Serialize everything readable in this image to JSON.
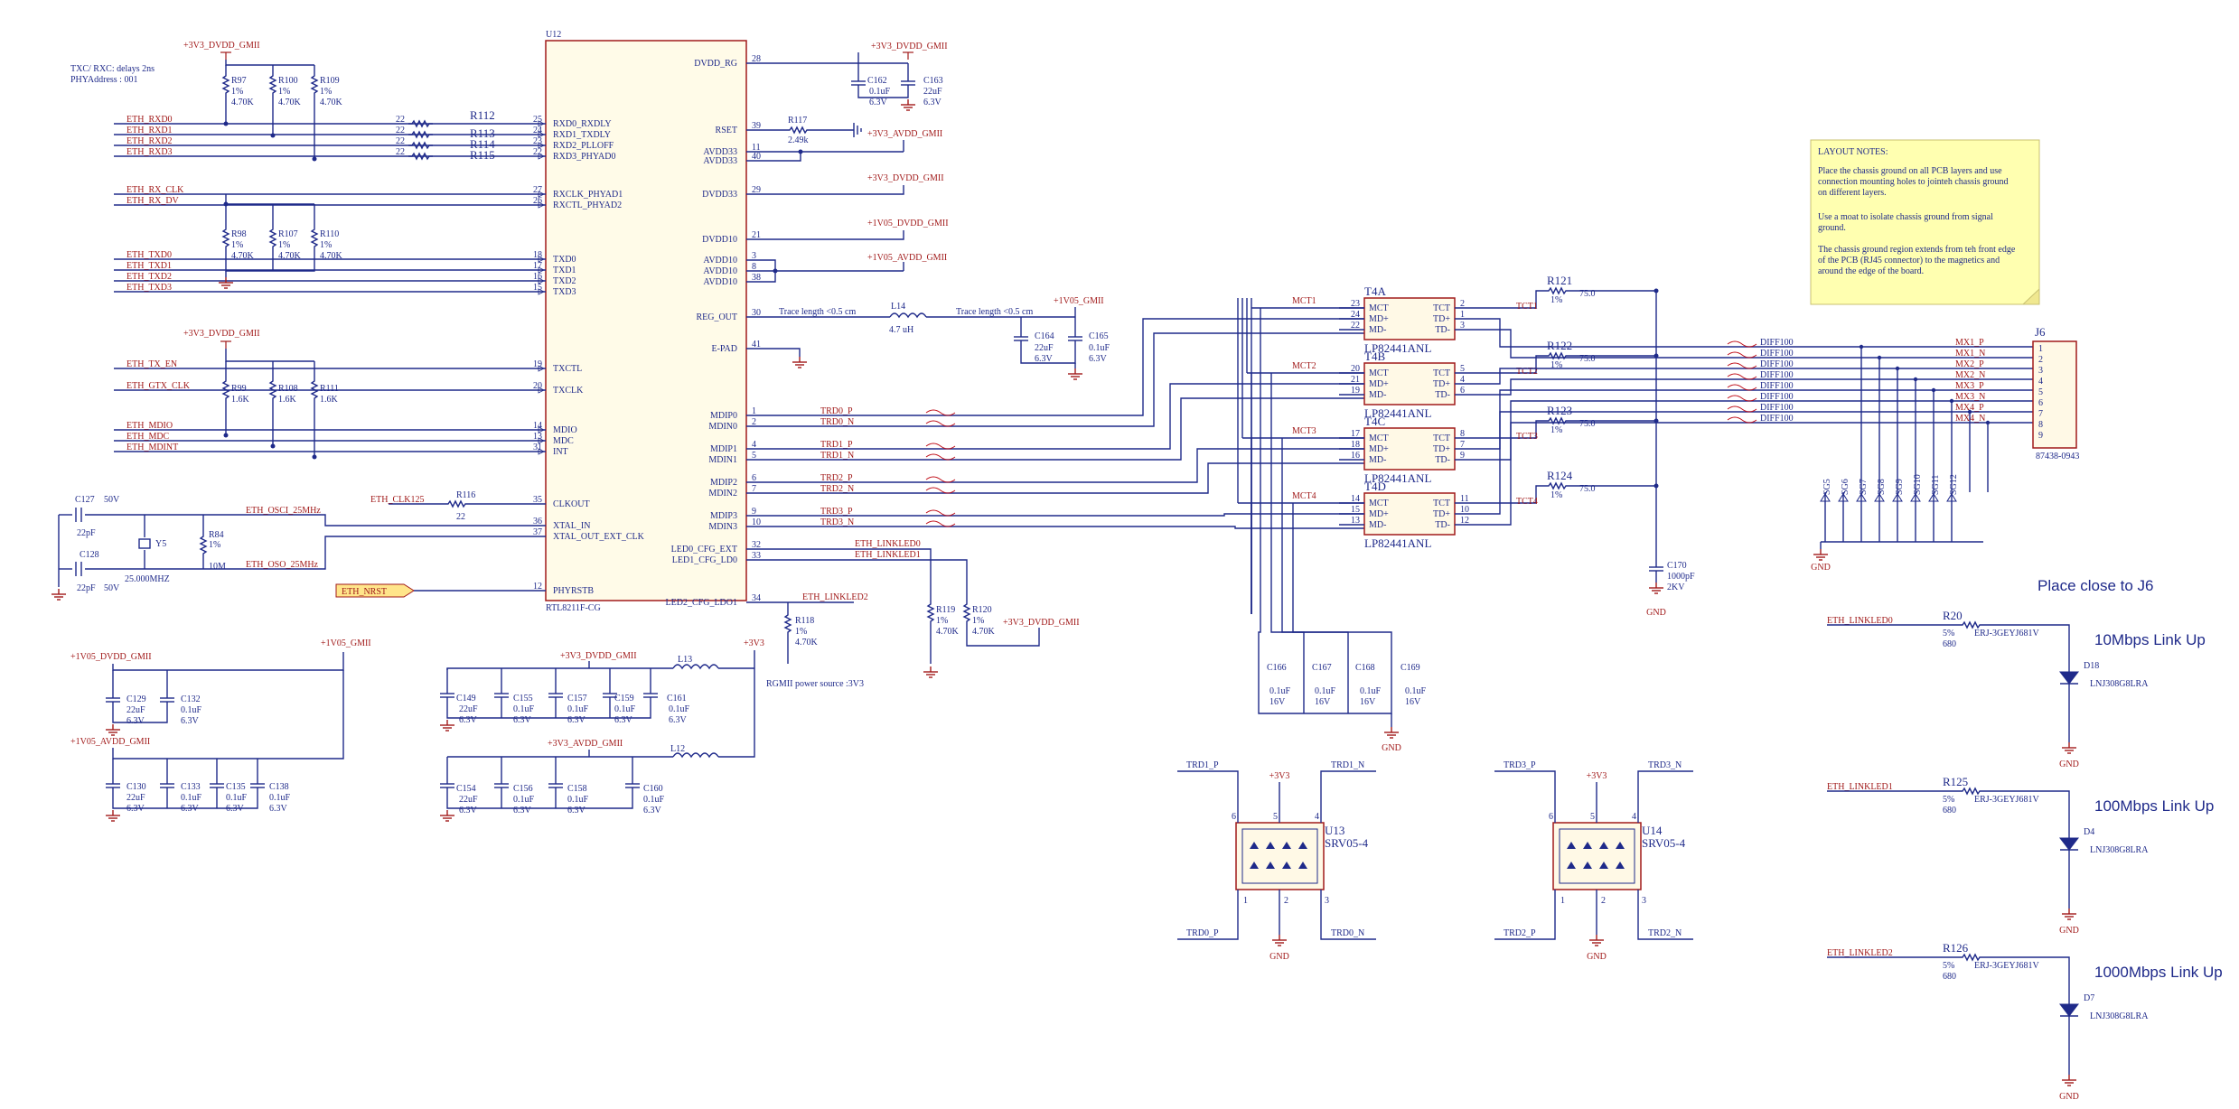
{
  "notes": {
    "delays": "TXC/ RXC: delays 2ns",
    "phy_address": "PHYAddress : 001",
    "rgmii": "RGMII power source :3V3"
  },
  "u12": {
    "ref": "U12",
    "part": "RTL8211F-CG",
    "left_pins": [
      {
        "num": "25",
        "name": "RXD0_RXDLY",
        "net": "ETH_RXD0",
        "res": "R112",
        "val": "22"
      },
      {
        "num": "24",
        "name": "RXD1_TXDLY",
        "net": "ETH_RXD1",
        "res": "R113",
        "val": "22"
      },
      {
        "num": "23",
        "name": "RXD2_PLLOFF",
        "net": "ETH_RXD2",
        "res": "R114",
        "val": "22"
      },
      {
        "num": "22",
        "name": "RXD3_PHYAD0",
        "net": "ETH_RXD3",
        "res": "R115",
        "val": "22"
      },
      {
        "num": "27",
        "name": "RXCLK_PHYAD1",
        "net": "ETH_RX_CLK"
      },
      {
        "num": "26",
        "name": "RXCTL_PHYAD2",
        "net": "ETH_RX_DV"
      },
      {
        "num": "18",
        "name": "TXD0",
        "net": "ETH_TXD0"
      },
      {
        "num": "17",
        "name": "TXD1",
        "net": "ETH_TXD1"
      },
      {
        "num": "16",
        "name": "TXD2",
        "net": "ETH_TXD2"
      },
      {
        "num": "15",
        "name": "TXD3",
        "net": "ETH_TXD3"
      },
      {
        "num": "19",
        "name": "TXCTL",
        "net": "ETH_TX_EN"
      },
      {
        "num": "20",
        "name": "TXCLK",
        "net": "ETH_GTX_CLK"
      },
      {
        "num": "14",
        "name": "MDIO",
        "net": "ETH_MDIO"
      },
      {
        "num": "13",
        "name": "MDC",
        "net": "ETH_MDC"
      },
      {
        "num": "31",
        "name": "INT",
        "net": "ETH_MDINT"
      },
      {
        "num": "35",
        "name": "CLKOUT",
        "net": "ETH_CLK125"
      },
      {
        "num": "36",
        "name": "XTAL_IN",
        "net": "ETH_OSCI_25MHz"
      },
      {
        "num": "37",
        "name": "XTAL_OUT_EXT_CLK",
        "net": "ETH_OSO_25MHz"
      },
      {
        "num": "12",
        "name": "PHYRSTB",
        "net": "ETH_NRST"
      }
    ],
    "right_pins": [
      {
        "num": "28",
        "name": "DVDD_RG"
      },
      {
        "num": "39",
        "name": "RSET"
      },
      {
        "num": "11",
        "name": "AVDD33"
      },
      {
        "num": "40",
        "name": "AVDD33"
      },
      {
        "num": "29",
        "name": "DVDD33"
      },
      {
        "num": "21",
        "name": "DVDD10"
      },
      {
        "num": "3",
        "name": "AVDD10"
      },
      {
        "num": "8",
        "name": "AVDD10"
      },
      {
        "num": "38",
        "name": "AVDD10"
      },
      {
        "num": "30",
        "name": "REG_OUT"
      },
      {
        "num": "41",
        "name": "E-PAD"
      },
      {
        "num": "1",
        "name": "MDIP0",
        "net": "TRD0_P"
      },
      {
        "num": "2",
        "name": "MDIN0",
        "net": "TRD0_N"
      },
      {
        "num": "4",
        "name": "MDIP1",
        "net": "TRD1_P"
      },
      {
        "num": "5",
        "name": "MDIN1",
        "net": "TRD1_N"
      },
      {
        "num": "6",
        "name": "MDIP2",
        "net": "TRD2_P"
      },
      {
        "num": "7",
        "name": "MDIN2",
        "net": "TRD2_N"
      },
      {
        "num": "9",
        "name": "MDIP3",
        "net": "TRD3_P"
      },
      {
        "num": "10",
        "name": "MDIN3",
        "net": "TRD3_N"
      },
      {
        "num": "32",
        "name": "LED0_CFG_EXT",
        "net": "ETH_LINKLED0"
      },
      {
        "num": "33",
        "name": "LED1_CFG_LD0",
        "net": "ETH_LINKLED1"
      },
      {
        "num": "34",
        "name": "LED2_CFG_LDO1",
        "net": "ETH_LINKLED2"
      }
    ]
  },
  "power": {
    "p3v3_dvdd": "+3V3_DVDD_GMII",
    "p3v3_avdd": "+3V3_AVDD_GMII",
    "p1v05_dvdd": "+1V05_DVDD_GMII",
    "p1v05_avdd": "+1V05_AVDD_GMII",
    "p1v05": "+1V05_GMII",
    "p3v3": "+3V3"
  },
  "pullups_top": [
    {
      "ref": "R97",
      "tol": "1%",
      "val": "4.70K"
    },
    {
      "ref": "R100",
      "tol": "1%",
      "val": "4.70K"
    },
    {
      "ref": "R109",
      "tol": "1%",
      "val": "4.70K"
    }
  ],
  "pulldowns": [
    {
      "ref": "R98",
      "tol": "1%",
      "val": "4.70K"
    },
    {
      "ref": "R107",
      "tol": "1%",
      "val": "4.70K"
    },
    {
      "ref": "R110",
      "tol": "1%",
      "val": "4.70K"
    }
  ],
  "mdio_pullups": [
    {
      "ref": "R99",
      "tol": "1%",
      "val": "1.6K"
    },
    {
      "ref": "R108",
      "tol": "1%",
      "val": "1.6K"
    },
    {
      "ref": "R111",
      "tol": "1%",
      "val": "1.6K"
    }
  ],
  "misc": {
    "r116": {
      "ref": "R116",
      "val": "22"
    },
    "r84": {
      "ref": "R84",
      "tol": "1%",
      "val": "10M"
    },
    "y5": {
      "ref": "Y5",
      "val": "25.000MHZ"
    },
    "c127": {
      "ref": "C127",
      "v": "50V",
      "val": "22pF"
    },
    "c128": {
      "ref": "C128",
      "val": "22pF",
      "v": "50V"
    },
    "r117": {
      "ref": "R117",
      "val": "2.49k"
    },
    "r118": {
      "ref": "R118",
      "tol": "1%",
      "val": "4.70K"
    },
    "r119": {
      "ref": "R119",
      "tol": "1%",
      "val": "4.70K"
    },
    "r120": {
      "ref": "R120",
      "tol": "1%",
      "val": "4.70K"
    },
    "c162": {
      "ref": "C162",
      "val": "0.1uF",
      "v": "6.3V"
    },
    "c163": {
      "ref": "C163",
      "val": "22uF",
      "v": "6.3V"
    },
    "l14": {
      "ref": "L14",
      "val": "4.7 uH"
    },
    "trace1": "Trace length <0.5 cm",
    "trace2": "Trace length <0.5 cm",
    "c164": {
      "ref": "C164",
      "val": "22uF",
      "v": "6.3V"
    },
    "c165": {
      "ref": "C165",
      "val": "0.1uF",
      "v": "6.3V"
    }
  },
  "decoupling": {
    "dvdd_gmii": [
      {
        "ref": "C129",
        "val": "22uF",
        "v": "6.3V"
      },
      {
        "ref": "C132",
        "val": "0.1uF",
        "v": "6.3V"
      }
    ],
    "avdd_gmii": [
      {
        "ref": "C130",
        "val": "22uF",
        "v": "6.3V"
      },
      {
        "ref": "C133",
        "val": "0.1uF",
        "v": "6.3V"
      },
      {
        "ref": "C135",
        "val": "0.1uF",
        "v": "6.3V"
      },
      {
        "ref": "C138",
        "val": "0.1uF",
        "v": "6.3V"
      }
    ],
    "dvdd33": [
      {
        "ref": "C149",
        "val": "22uF",
        "v": "6.3V"
      },
      {
        "ref": "C155",
        "val": "0.1uF",
        "v": "6.3V"
      },
      {
        "ref": "C157",
        "val": "0.1uF",
        "v": "6.3V"
      },
      {
        "ref": "C159",
        "val": "0.1uF",
        "v": "6.3V"
      },
      {
        "ref": "C161",
        "val": "0.1uF",
        "v": "6.3V"
      }
    ],
    "avdd33": [
      {
        "ref": "C154",
        "val": "22uF",
        "v": "6.3V"
      },
      {
        "ref": "C156",
        "val": "0.1uF",
        "v": "6.3V"
      },
      {
        "ref": "C158",
        "val": "0.1uF",
        "v": "6.3V"
      },
      {
        "ref": "C160",
        "val": "0.1uF",
        "v": "6.3V"
      }
    ],
    "l13": "L13",
    "l12": "L12"
  },
  "magnetics": {
    "part": "LP82441ANL",
    "pins": [
      "MCT",
      "MD+",
      "MD-",
      "TCT",
      "TD+",
      "TD-"
    ],
    "units": [
      {
        "ref": "T4A",
        "mct": "MCT1",
        "tct": "TCT1",
        "lp": [
          "23",
          "24",
          "22"
        ],
        "rp": [
          "2",
          "1",
          "3"
        ],
        "res": "R121",
        "tol": "1%",
        "val": "75.0"
      },
      {
        "ref": "T4B",
        "mct": "MCT2",
        "tct": "TCT2",
        "lp": [
          "20",
          "21",
          "19"
        ],
        "rp": [
          "5",
          "4",
          "6"
        ],
        "res": "R122",
        "tol": "1%",
        "val": "75.0"
      },
      {
        "ref": "T4C",
        "mct": "MCT3",
        "tct": "TCT3",
        "lp": [
          "17",
          "18",
          "16"
        ],
        "rp": [
          "8",
          "7",
          "9"
        ],
        "res": "R123",
        "tol": "1%",
        "val": "75.0"
      },
      {
        "ref": "T4D",
        "mct": "MCT4",
        "tct": "TCT4",
        "lp": [
          "14",
          "15",
          "13"
        ],
        "rp": [
          "11",
          "10",
          "12"
        ],
        "res": "R124",
        "tol": "1%",
        "val": "75.0"
      }
    ],
    "c170": {
      "ref": "C170",
      "val": "1000pF",
      "v": "2KV"
    },
    "caps": [
      {
        "ref": "C166",
        "val": "0.1uF",
        "v": "16V"
      },
      {
        "ref": "C167",
        "val": "0.1uF",
        "v": "16V"
      },
      {
        "ref": "C168",
        "val": "0.1uF",
        "v": "16V"
      },
      {
        "ref": "C169",
        "val": "0.1uF",
        "v": "16V"
      }
    ]
  },
  "diff_label": "DIFF100",
  "j6": {
    "ref": "J6",
    "part": "87438-0943",
    "nets": [
      "MX1_P",
      "MX1_N",
      "MX2_P",
      "MX2_N",
      "MX3_P",
      "MX3_N",
      "MX4_P",
      "MX4_N"
    ],
    "pins": [
      "1",
      "2",
      "3",
      "4",
      "5",
      "6",
      "7",
      "8",
      "9"
    ],
    "tvs": [
      "SG5",
      "SG6",
      "SG7",
      "SG8",
      "SG9",
      "SG10",
      "SG11",
      "SG12"
    ]
  },
  "layout_notes": {
    "title": "LAYOUT NOTES:",
    "l1": "Place the chassis ground on all PCB layers and use",
    "l2": "connection mounting holes to jointeh chassis ground",
    "l3": "on different layers.",
    "l4": "Use a moat to isolate chassis ground from signal",
    "l5": "ground.",
    "l6": "The chassis ground region extends from teh front edge",
    "l7": "of the PCB (RJ45 connector) to the magnetics and",
    "l8": "around the edge of the board."
  },
  "leds": {
    "place_close": "Place close to J6",
    "items": [
      {
        "net": "ETH_LINKLED0",
        "res": "R20",
        "tol": "5%",
        "val": "680",
        "rpart": "ERJ-3GEYJ681V",
        "ref": "D18",
        "part": "LNJ308G8LRA",
        "label": "10Mbps Link Up"
      },
      {
        "net": "ETH_LINKLED1",
        "res": "R125",
        "tol": "5%",
        "val": "680",
        "rpart": "ERJ-3GEYJ681V",
        "ref": "D4",
        "part": "LNJ308G8LRA",
        "label": "100Mbps Link Up"
      },
      {
        "net": "ETH_LINKLED2",
        "res": "R126",
        "tol": "5%",
        "val": "680",
        "rpart": "ERJ-3GEYJ681V",
        "ref": "D7",
        "part": "LNJ308G8LRA",
        "label": "1000Mbps Link Up"
      }
    ]
  },
  "esd": [
    {
      "ref": "U13",
      "part": "SRV05-4",
      "tl": "TRD1_P",
      "tr": "TRD1_N",
      "bl": "TRD0_P",
      "br": "TRD0_N"
    },
    {
      "ref": "U14",
      "part": "SRV05-4",
      "tl": "TRD3_P",
      "tr": "TRD3_N",
      "bl": "TRD2_P",
      "br": "TRD2_N"
    }
  ],
  "gnd": "GND"
}
